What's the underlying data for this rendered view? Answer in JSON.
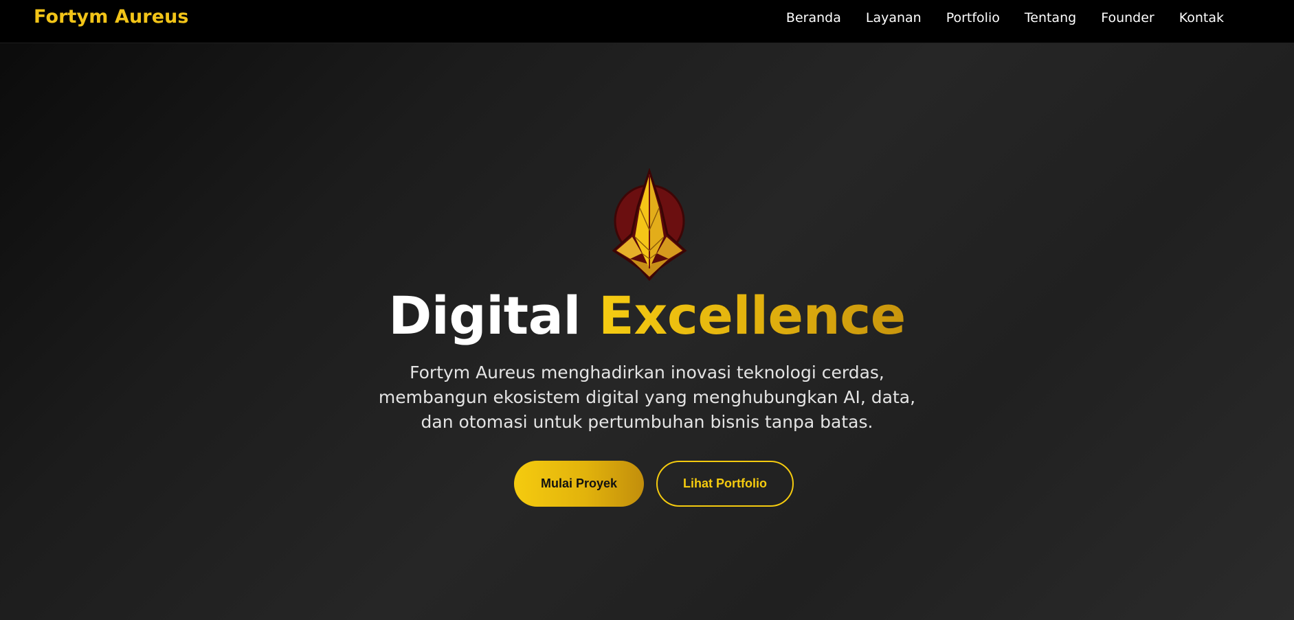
{
  "brand": {
    "name": "Fortym Aureus"
  },
  "nav": {
    "items": [
      {
        "label": "Beranda"
      },
      {
        "label": "Layanan"
      },
      {
        "label": "Portfolio"
      },
      {
        "label": "Tentang"
      },
      {
        "label": "Founder"
      },
      {
        "label": "Kontak"
      }
    ]
  },
  "hero": {
    "logo_icon": "golden-shield-emblem-icon",
    "title_part1": "Digital",
    "title_part2": "Excellence",
    "subtitle_lines": [
      "Fortym Aureus menghadirkan inovasi teknologi cerdas,",
      "membangun ekosistem digital yang menghubungkan AI, data,",
      "dan otomasi untuk pertumbuhan bisnis tanpa batas."
    ],
    "primary_button": "Mulai Proyek",
    "secondary_button": "Lihat Portfolio"
  },
  "colors": {
    "accent": "#F5CB0F",
    "accent_dark": "#C28E0C",
    "emblem_red": "#6B0F10",
    "nav_background": "#000000",
    "hero_background": "#1E1E1E"
  }
}
